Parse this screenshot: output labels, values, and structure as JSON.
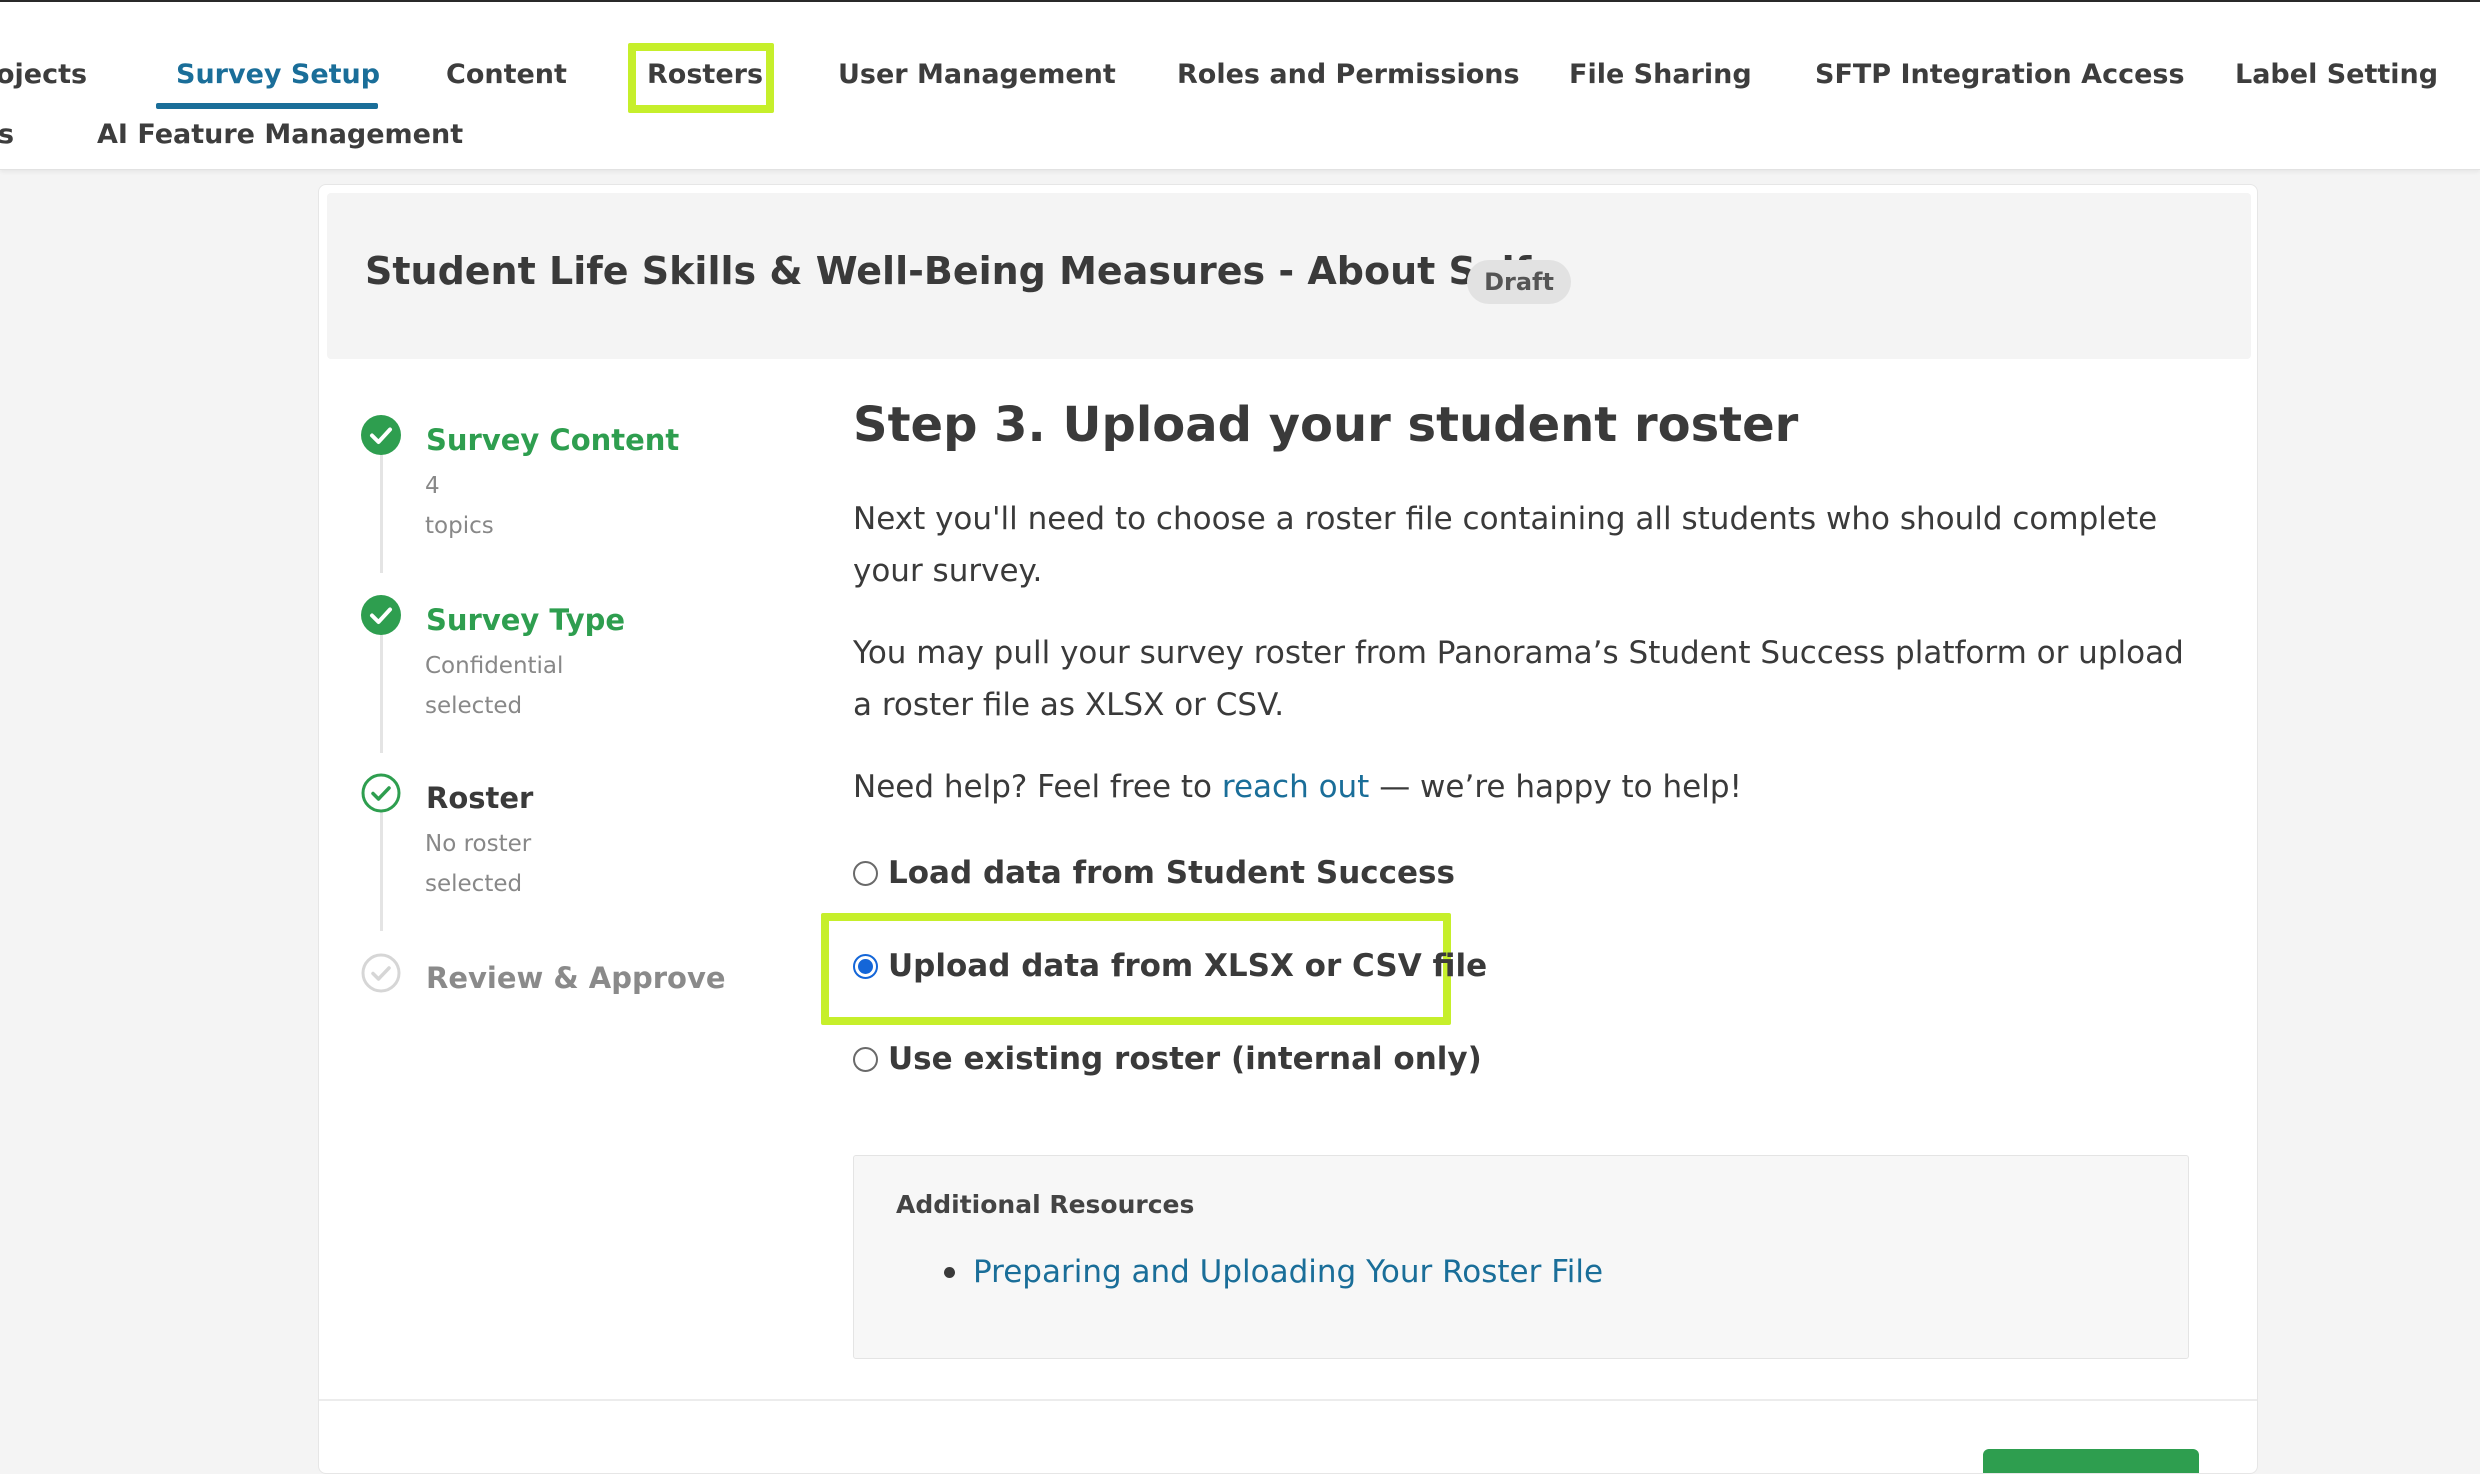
{
  "nav": {
    "row1": [
      "ojects",
      "Survey Setup",
      "Content",
      "Rosters",
      "User Management",
      "Roles and Permissions",
      "File Sharing",
      "SFTP Integration Access",
      "Label Setting"
    ],
    "row2": [
      "s",
      "AI Feature Management"
    ],
    "active": "Survey Setup",
    "highlighted": "Rosters"
  },
  "survey": {
    "title": "Student Life Skills & Well-Being Measures - About Self",
    "status_badge": "Draft"
  },
  "steps": [
    {
      "title": "Survey Content",
      "sub1": "4",
      "sub2": "topics",
      "state": "complete"
    },
    {
      "title": "Survey Type",
      "sub1": "Confidential",
      "sub2": "selected",
      "state": "complete"
    },
    {
      "title": "Roster",
      "sub1": "No roster",
      "sub2": "selected",
      "state": "current"
    },
    {
      "title": "Review & Approve",
      "state": "pending"
    }
  ],
  "main": {
    "heading": "Step 3. Upload your student roster",
    "para1": "Next you'll need to choose a roster file containing all students who should complete your survey.",
    "para2": "You may pull your survey roster from Panorama’s Student Success platform or upload a roster file as XLSX or CSV.",
    "help_prefix": "Need help? Feel free to ",
    "help_link": "reach out",
    "help_suffix": " — we’re happy to help!",
    "options": [
      {
        "label": "Load data from Student Success",
        "selected": false
      },
      {
        "label": "Upload data from XLSX or CSV file",
        "selected": true
      },
      {
        "label": "Use existing roster (internal only)",
        "selected": false
      }
    ]
  },
  "resources": {
    "title": "Additional Resources",
    "links": [
      "Preparing and Uploading Your Roster File"
    ]
  },
  "colors": {
    "accent": "#1a6e99",
    "success": "#2e9e4f",
    "highlight": "#c6ef2b",
    "radio": "#1466d8"
  }
}
